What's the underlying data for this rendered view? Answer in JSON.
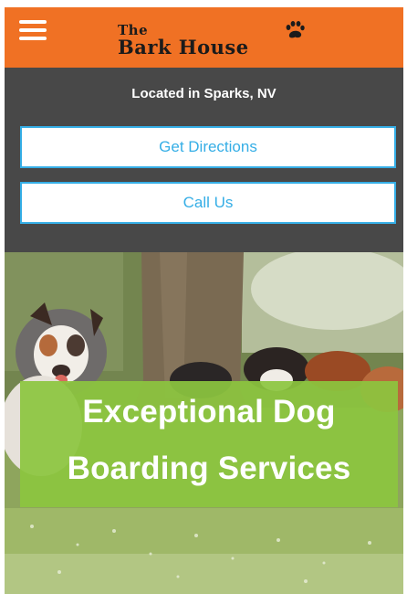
{
  "header": {
    "logo_the": "The",
    "logo_main": "Bark House",
    "brand_color": "#f07124",
    "menu_icon": "hamburger-menu-icon",
    "logo_icon": "paw-icon"
  },
  "info": {
    "location": "Located in Sparks, NV",
    "directions_label": "Get Directions",
    "call_label": "Call Us",
    "bar_color": "#484848",
    "button_accent": "#35aee6"
  },
  "hero": {
    "line1": "Exceptional Dog",
    "line2": "Boarding Services",
    "banner_color": "#8cc63f"
  }
}
